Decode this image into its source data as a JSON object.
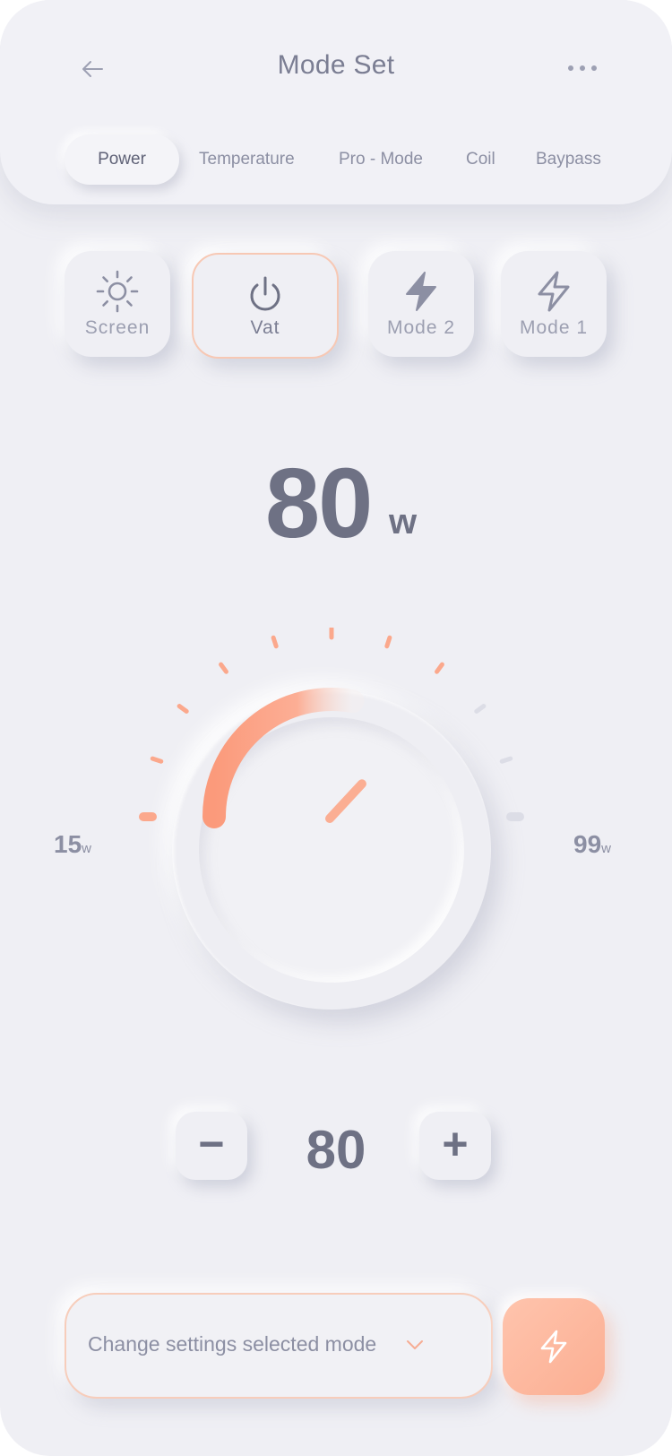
{
  "header": {
    "title": "Mode Set",
    "back_icon": "arrow-left-icon",
    "more_icon": "more-horizontal-icon"
  },
  "tabs": [
    {
      "label": "Power",
      "active": true
    },
    {
      "label": "Temperature",
      "active": false
    },
    {
      "label": "Pro - Mode",
      "active": false
    },
    {
      "label": "Coil",
      "active": false
    },
    {
      "label": "Baypass",
      "active": false
    }
  ],
  "modes": [
    {
      "label": "Screen",
      "icon": "sun-icon",
      "active": false
    },
    {
      "label": "Vat",
      "icon": "power-icon",
      "active": true
    },
    {
      "label": "Mode 2",
      "icon": "lightning-filled-icon",
      "active": false
    },
    {
      "label": "Mode 1",
      "icon": "lightning-outline-icon",
      "active": false
    }
  ],
  "power": {
    "value": "80",
    "unit": "w"
  },
  "dial": {
    "min_label": "15",
    "min_unit": "w",
    "max_label": "99",
    "max_unit": "w",
    "min": 15,
    "max": 99,
    "value": 80
  },
  "stepper": {
    "minus_label": "−",
    "value": "80",
    "plus_label": "+"
  },
  "footer": {
    "select_text": "Change settings selected mode",
    "chevron_icon": "chevron-down-icon",
    "action_icon": "lightning-outline-icon"
  },
  "colors": {
    "accent": "#fa9a7c",
    "text_primary": "#6e7184",
    "background": "#efeff4"
  }
}
